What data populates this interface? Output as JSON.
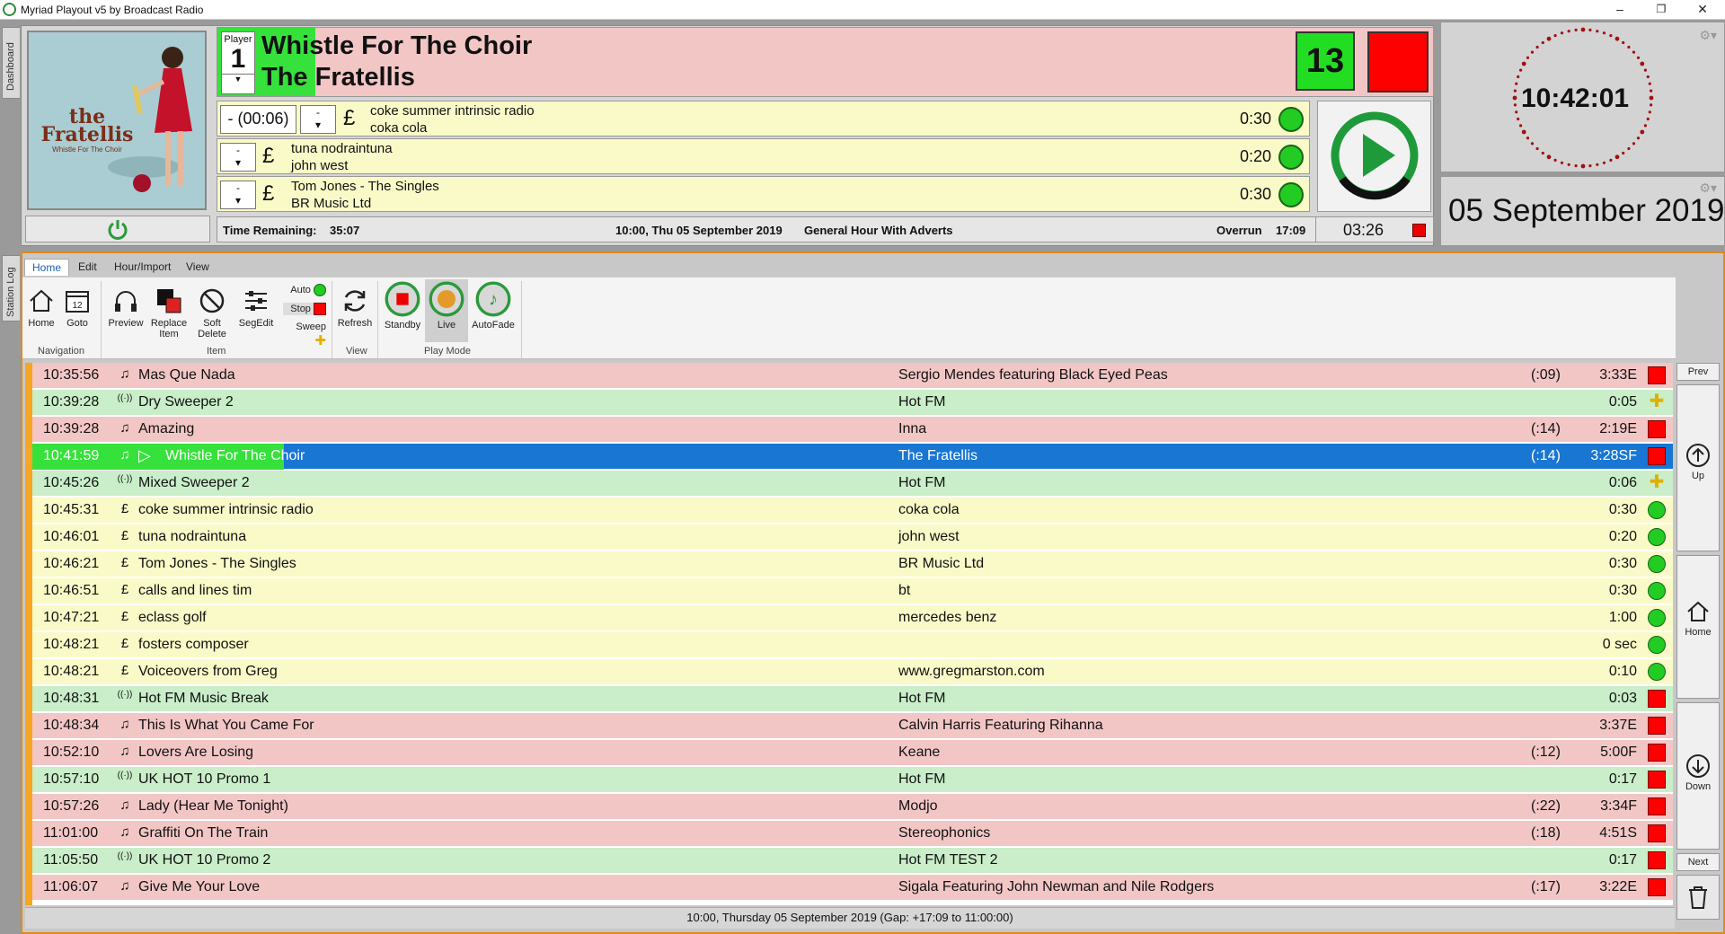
{
  "window": {
    "title": "Myriad Playout v5 by Broadcast Radio",
    "controls": [
      "–",
      "❐",
      "✕"
    ]
  },
  "side_tabs": {
    "dashboard": "Dashboard",
    "station_log": "Station Log"
  },
  "album": {
    "band": "the Fratellis",
    "subtitle": "Whistle For The Choir"
  },
  "player": {
    "label": "Player",
    "number": "1",
    "title": "Whistle For The Choir",
    "artist": "The Fratellis",
    "progress_fraction": 0.0801,
    "count": "13"
  },
  "queue": [
    {
      "spin": "- (00:06)",
      "extra": "-",
      "line1": "coke summer intrinsic radio",
      "line2": "coka cola",
      "duration": "0:30"
    },
    {
      "spin": "-",
      "line1": "tuna nodraintuna",
      "line2": "john west",
      "duration": "0:20"
    },
    {
      "spin": "-",
      "line1": "Tom Jones - The Singles",
      "line2": "BR Music Ltd",
      "duration": "0:30"
    }
  ],
  "status": {
    "time_remaining_label": "Time Remaining:",
    "time_remaining": "35:07",
    "hour_info": "10:00, Thu 05 September 2019",
    "hour_name": "General Hour With Adverts",
    "overrun_label": "Overrun",
    "overrun": "17:09",
    "countdown": "03:26"
  },
  "clock": {
    "time": "10:42:01",
    "date": "05 September 2019"
  },
  "ribbon": {
    "tabs": [
      "Home",
      "Edit",
      "Hour/Import",
      "View"
    ],
    "buttons": {
      "home": "Home",
      "goto": "Goto",
      "preview": "Preview",
      "replace": "Replace Item",
      "soft_delete": "Soft Delete",
      "segedit": "SegEdit",
      "auto": "Auto",
      "stop": "Stop",
      "sweep": "Sweep",
      "refresh": "Refresh",
      "standby": "Standby",
      "live": "Live",
      "autofade": "AutoFade"
    },
    "groups": {
      "navigation": "Navigation",
      "item": "Item",
      "view": "View",
      "play_mode": "Play Mode"
    },
    "goto_day": "12"
  },
  "log": [
    {
      "time": "10:35:56",
      "icon": "music-note-icon",
      "glyph": "♫",
      "title": "Mas Que Nada",
      "artist": "Sergio Mendes featuring Black Eyed Peas",
      "intro": "(:09)",
      "duration": "3:33E",
      "color": "red",
      "mark": "red"
    },
    {
      "time": "10:39:28",
      "icon": "broadcast-icon",
      "glyph": "((·))",
      "title": "Dry Sweeper 2",
      "artist": "Hot FM",
      "intro": "",
      "duration": "0:05",
      "color": "green",
      "mark": "plus"
    },
    {
      "time": "10:39:28",
      "icon": "music-note-icon",
      "glyph": "♫",
      "title": "Amazing",
      "artist": "Inna",
      "intro": "(:14)",
      "duration": "2:19E",
      "color": "red",
      "mark": "red"
    },
    {
      "time": "10:41:59",
      "icon": "music-note-icon",
      "glyph": "♫",
      "title": "Whistle For The Choir",
      "artist": "The Fratellis",
      "intro": "(:14)",
      "duration": "3:28SF",
      "color": "sel",
      "mark": "red"
    },
    {
      "time": "10:45:26",
      "icon": "broadcast-icon",
      "glyph": "((·))",
      "title": "Mixed Sweeper 2",
      "artist": "Hot FM",
      "intro": "",
      "duration": "0:06",
      "color": "green",
      "mark": "plus"
    },
    {
      "time": "10:45:31",
      "icon": "pound-icon",
      "glyph": "£",
      "title": "coke summer intrinsic radio",
      "artist": "coka cola",
      "intro": "",
      "duration": "0:30",
      "color": "yellow",
      "mark": "green"
    },
    {
      "time": "10:46:01",
      "icon": "pound-icon",
      "glyph": "£",
      "title": "tuna nodraintuna",
      "artist": "john west",
      "intro": "",
      "duration": "0:20",
      "color": "yellow",
      "mark": "green"
    },
    {
      "time": "10:46:21",
      "icon": "pound-icon",
      "glyph": "£",
      "title": "Tom Jones - The Singles",
      "artist": "BR Music Ltd",
      "intro": "",
      "duration": "0:30",
      "color": "yellow",
      "mark": "green"
    },
    {
      "time": "10:46:51",
      "icon": "pound-icon",
      "glyph": "£",
      "title": "calls and lines tim",
      "artist": "bt",
      "intro": "",
      "duration": "0:30",
      "color": "yellow",
      "mark": "green"
    },
    {
      "time": "10:47:21",
      "icon": "pound-icon",
      "glyph": "£",
      "title": "eclass golf",
      "artist": "mercedes benz",
      "intro": "",
      "duration": "1:00",
      "color": "yellow",
      "mark": "green"
    },
    {
      "time": "10:48:21",
      "icon": "pound-icon",
      "glyph": "£",
      "title": "fosters composer",
      "artist": "",
      "intro": "",
      "duration": "0 sec",
      "color": "yellow",
      "mark": "green"
    },
    {
      "time": "10:48:21",
      "icon": "pound-icon",
      "glyph": "£",
      "title": "Voiceovers from Greg",
      "artist": "www.gregmarston.com",
      "intro": "",
      "duration": "0:10",
      "color": "yellow",
      "mark": "green"
    },
    {
      "time": "10:48:31",
      "icon": "broadcast-icon",
      "glyph": "((·))",
      "title": "Hot FM Music Break",
      "artist": "Hot FM",
      "intro": "",
      "duration": "0:03",
      "color": "green",
      "mark": "red"
    },
    {
      "time": "10:48:34",
      "icon": "music-note-icon",
      "glyph": "♫",
      "title": "This Is What You Came For",
      "artist": "Calvin Harris Featuring Rihanna",
      "intro": "",
      "duration": "3:37E",
      "color": "red",
      "mark": "red"
    },
    {
      "time": "10:52:10",
      "icon": "music-note-icon",
      "glyph": "♫",
      "title": "Lovers Are Losing",
      "artist": "Keane",
      "intro": "(:12)",
      "duration": "5:00F",
      "color": "red",
      "mark": "red"
    },
    {
      "time": "10:57:10",
      "icon": "broadcast-icon",
      "glyph": "((·))",
      "title": "UK HOT 10 Promo 1",
      "artist": "Hot FM",
      "intro": "",
      "duration": "0:17",
      "color": "green",
      "mark": "red"
    },
    {
      "time": "10:57:26",
      "icon": "music-note-icon",
      "glyph": "♫",
      "title": "Lady (Hear Me Tonight)",
      "artist": "Modjo",
      "intro": "(:22)",
      "duration": "3:34F",
      "color": "red",
      "mark": "red"
    },
    {
      "time": "11:01:00",
      "icon": "music-note-icon",
      "glyph": "♫",
      "title": "Graffiti On The Train",
      "artist": "Stereophonics",
      "intro": "(:18)",
      "duration": "4:51S",
      "color": "red",
      "mark": "red"
    },
    {
      "time": "11:05:50",
      "icon": "broadcast-icon",
      "glyph": "((·))",
      "title": "UK HOT 10 Promo 2",
      "artist": "Hot FM TEST 2",
      "intro": "",
      "duration": "0:17",
      "color": "green",
      "mark": "red"
    },
    {
      "time": "11:06:07",
      "icon": "music-note-icon",
      "glyph": "♫",
      "title": "Give Me Your Love",
      "artist": "Sigala Featuring John Newman and Nile Rodgers",
      "intro": "(:17)",
      "duration": "3:22E",
      "color": "red",
      "mark": "red"
    }
  ],
  "footer": "10:00, Thursday 05 September 2019 (Gap: +17:09 to 11:00:00)",
  "nav": {
    "prev": "Prev",
    "up": "Up",
    "home": "Home",
    "down": "Down",
    "next": "Next"
  }
}
